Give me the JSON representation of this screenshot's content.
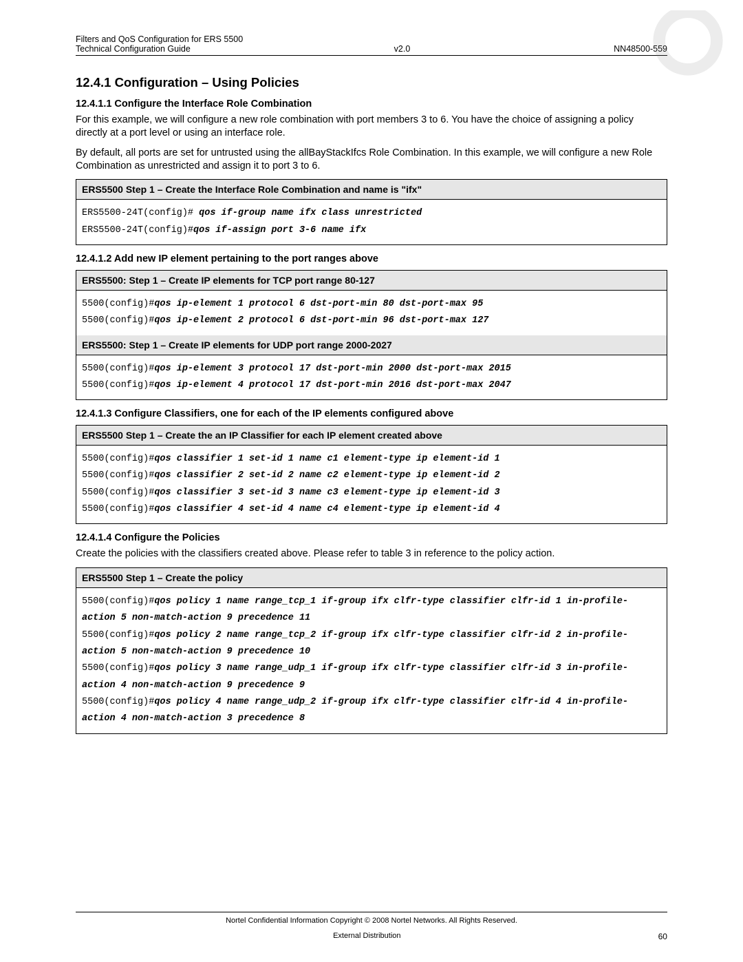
{
  "header": {
    "line1_left": "Filters and QoS Configuration for ERS 5500",
    "line2_left": "Technical Configuration Guide",
    "center": "v2.0",
    "right": "NN48500-559"
  },
  "section_title": "12.4.1 Configuration – Using Policies",
  "s1": {
    "heading": "12.4.1.1   Configure the Interface Role Combination",
    "p1": "For this example, we will configure a new role combination with port members 3 to 6. You have the choice of assigning a policy directly at a port level or using an interface role.",
    "p2": "By default, all ports are set for untrusted using the allBayStackIfcs Role Combination. In this example, we will configure a new Role Combination as unrestricted and assign it to port 3 to 6.",
    "step_title": "ERS5500 Step 1  – Create the Interface Role Combination and name is \"ifx\"",
    "cmds": [
      {
        "prefix": "ERS5500-24T(config)# ",
        "bold": "qos if-group name ifx class unrestricted"
      },
      {
        "prefix": "ERS5500-24T(config)#",
        "bold": "qos if-assign port 3-6 name ifx"
      }
    ]
  },
  "s2": {
    "heading": "12.4.1.2   Add new IP element pertaining to the port ranges above",
    "step1_title": "ERS5500: Step 1 – Create IP elements  for TCP port range 80-127",
    "step1_cmds": [
      {
        "prefix": "5500(config)#",
        "bold": "qos ip-element 1 protocol 6 dst-port-min 80 dst-port-max 95"
      },
      {
        "prefix": "5500(config)#",
        "bold": "qos ip-element 2 protocol 6 dst-port-min 96 dst-port-max 127"
      }
    ],
    "step2_title": "ERS5500: Step 1 – Create IP elements  for UDP port range 2000-2027",
    "step2_cmds": [
      {
        "prefix": "5500(config)#",
        "bold": "qos ip-element 3 protocol 17 dst-port-min 2000 dst-port-max 2015"
      },
      {
        "prefix": "5500(config)#",
        "bold": "qos ip-element 4 protocol 17 dst-port-min 2016 dst-port-max 2047"
      }
    ]
  },
  "s3": {
    "heading": "12.4.1.3   Configure Classifiers, one for each of the IP elements configured above",
    "step_title": "ERS5500 Step 1  – Create the an IP Classifier for each IP element created above",
    "cmds": [
      {
        "prefix": "5500(config)#",
        "bold": "qos classifier 1 set-id 1 name c1 element-type ip element-id 1"
      },
      {
        "prefix": "5500(config)#",
        "bold": "qos classifier 2 set-id 2 name c2 element-type ip element-id 2"
      },
      {
        "prefix": "5500(config)#",
        "bold": "qos classifier 3 set-id 3 name c3 element-type ip element-id 3"
      },
      {
        "prefix": "5500(config)#",
        "bold": "qos classifier 4 set-id 4 name c4 element-type ip element-id 4"
      }
    ]
  },
  "s4": {
    "heading": "12.4.1.4   Configure the Policies",
    "p1": "Create the policies with the classifiers created above. Please refer to table 3 in reference to the policy action.",
    "step_title": "ERS5500 Step 1  – Create the policy",
    "cmds": [
      {
        "prefix": "5500(config)#",
        "bold": "qos policy 1 name range_tcp_1 if-group ifx clfr-type classifier clfr-id 1 in-profile-action 5 non-match-action 9 precedence 11"
      },
      {
        "prefix": "5500(config)#",
        "bold": "qos policy 2 name range_tcp_2 if-group ifx clfr-type classifier clfr-id 2 in-profile-action 5 non-match-action 9 precedence 10"
      },
      {
        "prefix": "5500(config)#",
        "bold": "qos policy 3 name range_udp_1 if-group ifx clfr-type classifier clfr-id 3 in-profile-action 4 non-match-action 9 precedence 9"
      },
      {
        "prefix": "5500(config)#",
        "bold": "qos policy 4 name range_udp_2 if-group ifx clfr-type classifier clfr-id 4 in-profile-action 4 non-match-action 3 precedence 8"
      }
    ]
  },
  "footer": {
    "line1": "Nortel Confidential Information   Copyright © 2008 Nortel Networks. All Rights Reserved.",
    "line2": "External Distribution",
    "page": "60"
  }
}
